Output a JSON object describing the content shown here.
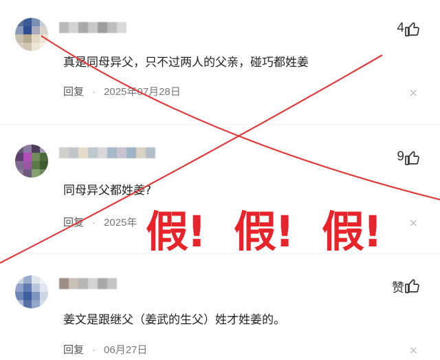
{
  "comments": [
    {
      "likes": "4",
      "text": "真是同母异父，只不过两人的父亲，碰巧都姓姜",
      "reply_label": "回复",
      "separator": "·",
      "date": "2025年07月28日",
      "close": "×"
    },
    {
      "likes": "9",
      "text": "同母异父都姓姜?",
      "reply_label": "回复",
      "separator": "·",
      "date": "2025年",
      "close": "×"
    },
    {
      "likes": "赞",
      "text": "姜文是跟继父（姜武的生父）姓才姓姜的。",
      "reply_label": "回复",
      "separator": "·",
      "date": "06月27日",
      "close": "×"
    }
  ],
  "overlay": {
    "stamps": [
      "假!",
      "假!",
      "假!"
    ],
    "cross_color": "#e03a3a",
    "stamp_color": "#e8232a"
  },
  "icons": {
    "like": "thumbs-up-icon",
    "close": "close-icon"
  }
}
